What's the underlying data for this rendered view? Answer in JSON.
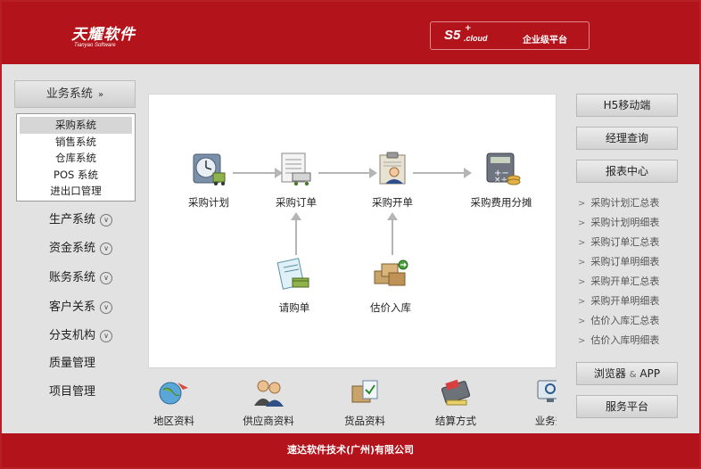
{
  "header": {
    "logo_cn": "天耀软件",
    "logo_en": "Tianyao Software",
    "badge_main": "S5",
    "badge_sup": "+",
    "badge_cloud": ".cloud",
    "badge_text": "企业级平台"
  },
  "sidebar": {
    "top_label": "业务系统",
    "submenu": [
      "采购系统",
      "销售系统",
      "仓库系统",
      "POS 系统",
      "进出口管理"
    ],
    "items": [
      {
        "label": "生产系统",
        "expandable": true
      },
      {
        "label": "资金系统",
        "expandable": true
      },
      {
        "label": "账务系统",
        "expandable": true
      },
      {
        "label": "客户关系",
        "expandable": true
      },
      {
        "label": "分支机构",
        "expandable": true
      },
      {
        "label": "质量管理",
        "expandable": false
      },
      {
        "label": "项目管理",
        "expandable": false
      }
    ]
  },
  "flow": {
    "nodes": [
      "采购计划",
      "采购订单",
      "采购开单",
      "采购费用分摊",
      "请购单",
      "估价入库"
    ]
  },
  "bottom_icons": [
    "地区资料",
    "供应商资料",
    "货品资料",
    "结算方式",
    "业务查"
  ],
  "right": {
    "buttons": [
      "H5移动端",
      "经理查询",
      "报表中心"
    ],
    "reports": [
      "采购计划汇总表",
      "采购计划明细表",
      "采购订单汇总表",
      "采购订单明细表",
      "采购开单汇总表",
      "采购开单明细表",
      "估价入库汇总表",
      "估价入库明细表"
    ],
    "browser_label": "浏览器",
    "browser_amp": "&",
    "browser_app": "APP",
    "service_label": "服务平台"
  },
  "footer": {
    "company": "速达软件技术(广州)有限公司"
  },
  "colors": {
    "brand_red": "#b3131b",
    "panel_bg": "#e2e2e2"
  }
}
